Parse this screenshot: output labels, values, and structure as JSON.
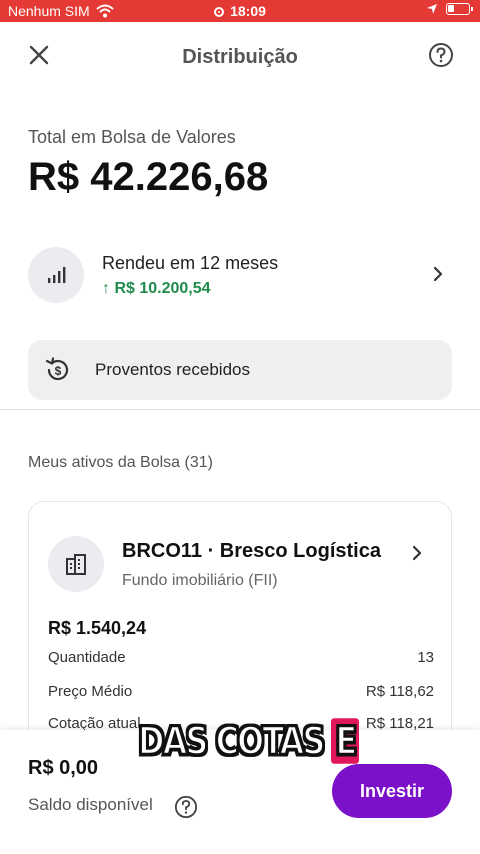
{
  "status_bar": {
    "carrier": "Nenhum SIM",
    "time": "18:09",
    "battery_level": 0.3,
    "icons": [
      "wifi-icon",
      "record-icon",
      "location-icon",
      "battery-icon"
    ]
  },
  "header": {
    "title": "Distribuição",
    "icons": [
      "close-icon",
      "help-icon"
    ]
  },
  "total": {
    "label": "Total em Bolsa de Valores",
    "value": "R$ 42.226,68"
  },
  "rendeu": {
    "title": "Rendeu em 12 meses",
    "arrow": "↑",
    "value": "R$ 10.200,54",
    "icons": [
      "signal-bars-icon",
      "chevron-right-icon"
    ]
  },
  "proventos": {
    "label": "Proventos recebidos",
    "icon": "dividend-history-icon"
  },
  "meus_ativos": {
    "label": "Meus ativos da Bolsa (31)"
  },
  "asset": {
    "name": "BRCO11 · Bresco Logística",
    "type": "Fundo imobiliário (FII)",
    "value": "R$ 1.540,24",
    "icons": [
      "building-icon",
      "chevron-right-icon"
    ],
    "details": [
      {
        "label": "Quantidade",
        "value": "13"
      },
      {
        "label": "Preço Médio",
        "value": "R$ 118,62"
      },
      {
        "label": "Cotação atual",
        "value": "R$ 118,21"
      }
    ]
  },
  "bottom": {
    "saldo_value": "R$ 0,00",
    "saldo_label": "Saldo disponível",
    "invest_label": "Investir"
  },
  "caption": {
    "text": "DAS COTAS",
    "highlight": "E"
  },
  "colors": {
    "status_bar": "#e53935",
    "accent_purple": "#7b12c9",
    "positive_green": "#1f8b4c",
    "caption_highlight": "#e0185a"
  }
}
